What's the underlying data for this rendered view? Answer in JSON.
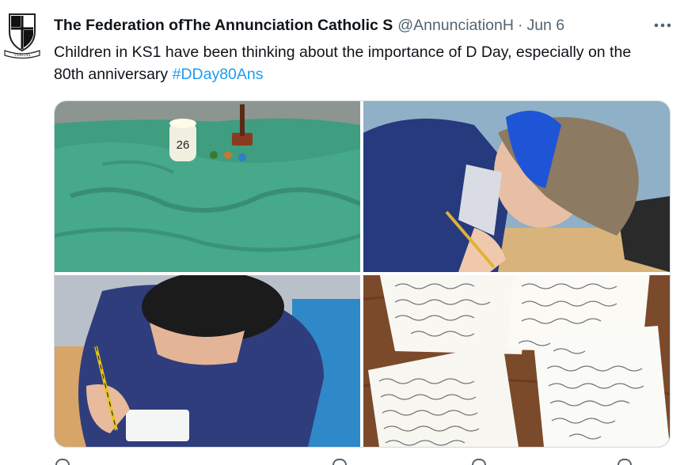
{
  "account": {
    "display_name": "The Federation ofThe Annunciation Catholic S",
    "handle": "@AnnunciationH",
    "separator": "·",
    "date": "Jun 6",
    "crest_motto": "VERITAS"
  },
  "tweet": {
    "text": "Children in KS1 have been thinking about the importance of D Day, especially on the 80th anniversary ",
    "hashtag": "#DDay80Ans"
  },
  "media": {
    "candle_number": "26",
    "letter_top_left": "Dear God thank you for soldiers who were fighting, D-day, we are thankful God bless them amen",
    "letter_top_right": "who were there on D-Day. And for their bravery. Even for the ones that are still here today. From",
    "letter_bottom_left": "Dear my loving God, thankyou for the soilgers who were in D-day and for them protecting us and their brave ness. Thank you for all the kindness you gave them. Thank you for guiding",
    "letter_bottom_right": "Loving God, Thank you for the soldiers courage and bravery in D Day. Amen From Aran"
  },
  "icons": [
    "more-icon",
    "crest-icon",
    "reply-icon",
    "retweet-icon",
    "like-icon",
    "views-icon",
    "bookmark-icon",
    "share-icon"
  ],
  "colors": {
    "hashtag": "#1d9bf0",
    "secondary_text": "#536471",
    "border": "#cfd9de"
  }
}
